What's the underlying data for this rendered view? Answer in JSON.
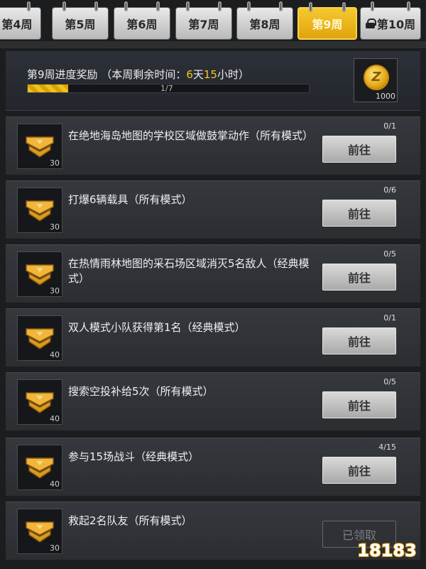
{
  "tabs": [
    {
      "label": "第4周",
      "active": false,
      "locked": false
    },
    {
      "label": "第5周",
      "active": false,
      "locked": false
    },
    {
      "label": "第6周",
      "active": false,
      "locked": false
    },
    {
      "label": "第7周",
      "active": false,
      "locked": false
    },
    {
      "label": "第8周",
      "active": false,
      "locked": false
    },
    {
      "label": "第9周",
      "active": true,
      "locked": false
    },
    {
      "label": "第10周",
      "active": false,
      "locked": true
    }
  ],
  "progress": {
    "title_prefix": "第9周进度奖励 （本周剩余时间：",
    "days": "6",
    "days_unit": "天",
    "hours": "15",
    "hours_unit": "小时）",
    "count_text": "1/7",
    "fraction": 0.143,
    "reward_amount": "1000",
    "reward_icon": "coin-icon"
  },
  "missions": [
    {
      "text": "在绝地海岛地图的学校区域做鼓掌动作（所有模式）",
      "count": "0/1",
      "points": "30",
      "button": "前往",
      "claimed": false
    },
    {
      "text": "打爆6辆载具（所有模式）",
      "count": "0/6",
      "points": "30",
      "button": "前往",
      "claimed": false
    },
    {
      "text": "在热情雨林地图的采石场区域消灭5名敌人（经典模式）",
      "count": "0/5",
      "points": "30",
      "button": "前往",
      "claimed": false
    },
    {
      "text": "双人模式小队获得第1名（经典模式）",
      "count": "0/1",
      "points": "40",
      "button": "前往",
      "claimed": false
    },
    {
      "text": "搜索空投补给5次（所有模式）",
      "count": "0/5",
      "points": "40",
      "button": "前往",
      "claimed": false
    },
    {
      "text": "参与15场战斗（经典模式）",
      "count": "4/15",
      "points": "40",
      "button": "前往",
      "claimed": false
    },
    {
      "text": "救起2名队友（所有模式）",
      "count": "",
      "points": "30",
      "button": "已领取",
      "claimed": true
    }
  ],
  "watermark": {
    "text": "18183",
    "icon": "18183-logo-icon"
  },
  "colors": {
    "accent": "#f4c623",
    "active_tab": "#e9b21a",
    "panel": "#2f3136"
  }
}
